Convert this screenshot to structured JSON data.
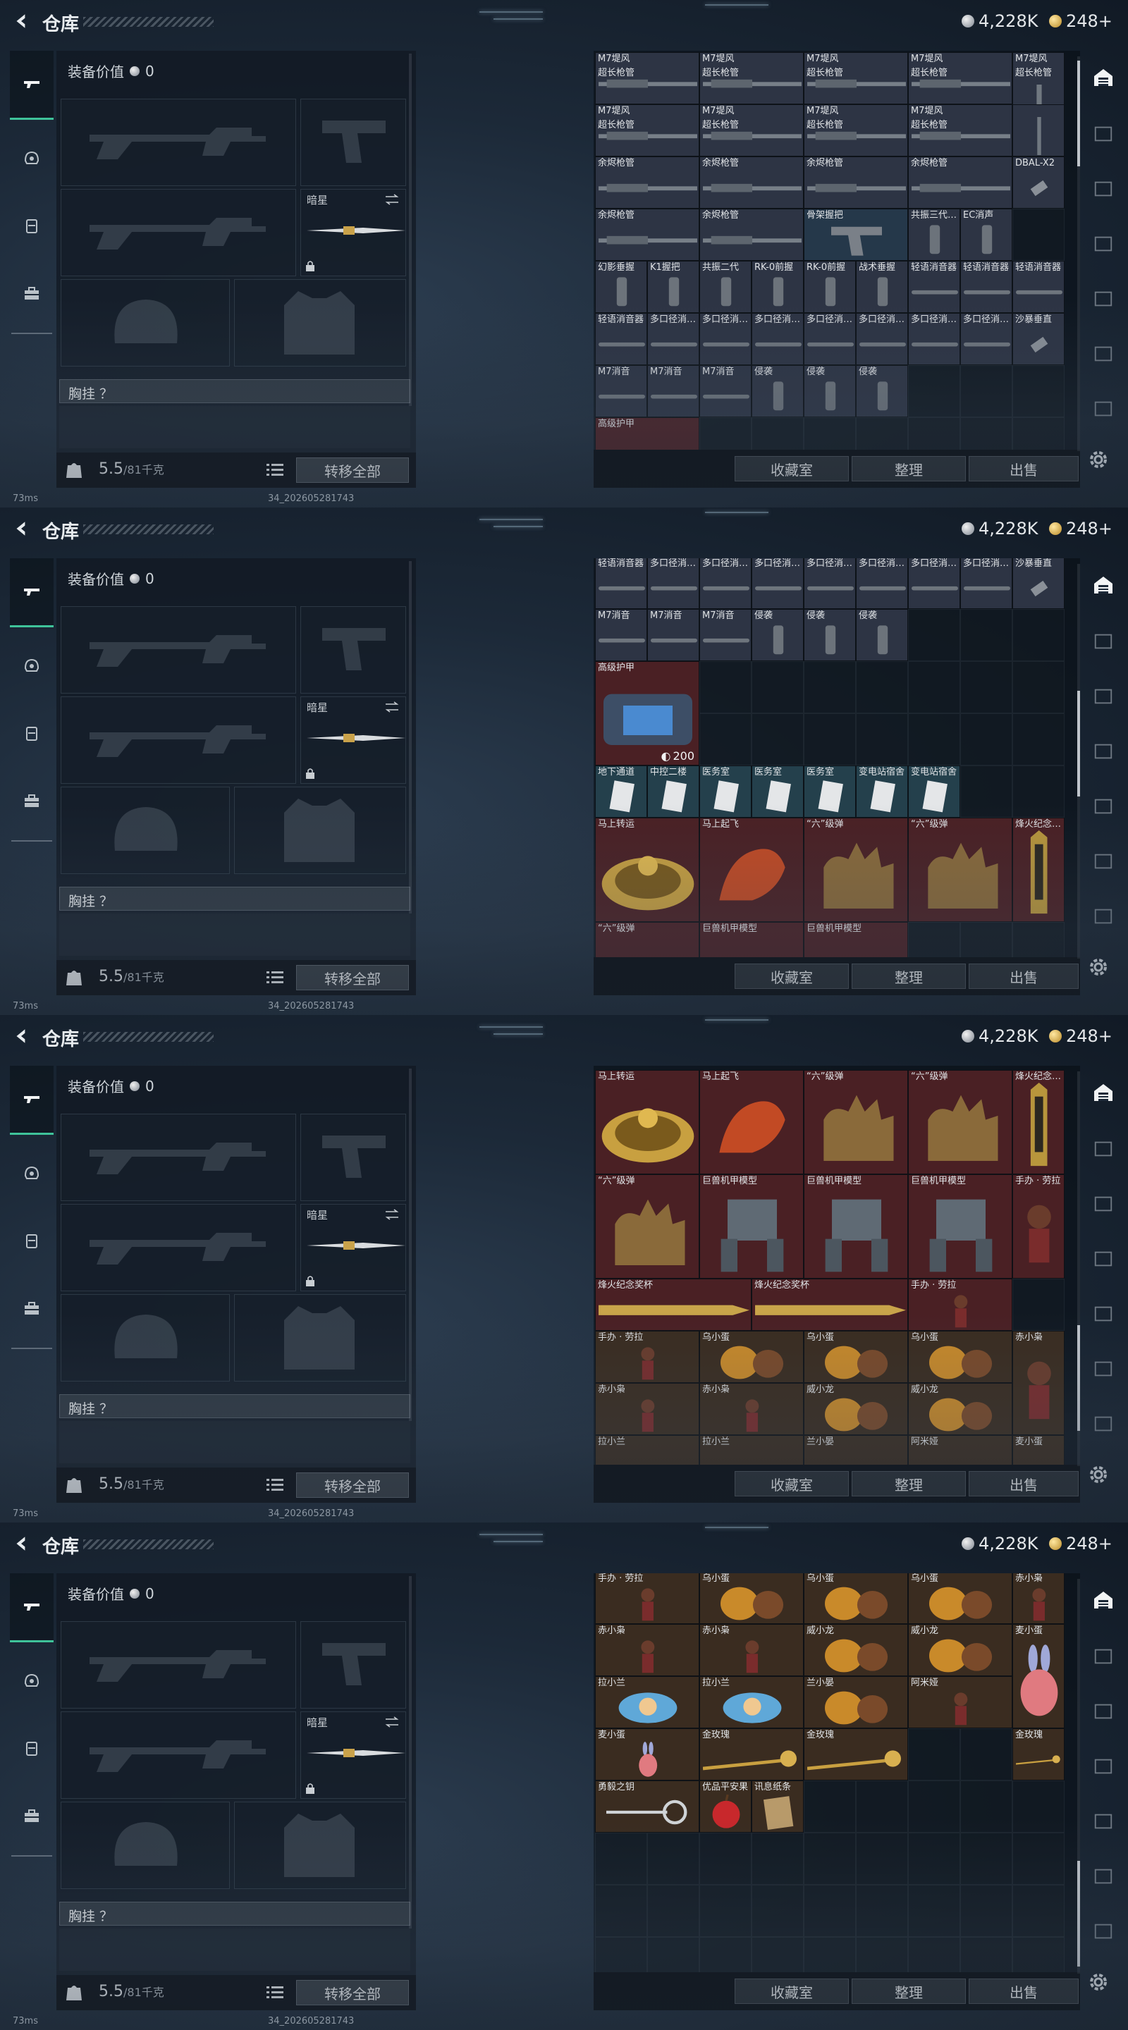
{
  "colors": {
    "accent_green": "#3fc39a",
    "weapon_cell": "#2d3444",
    "weapon_cell_blue": "#25384a",
    "collectible_red": "#4a2024",
    "collectible_brown": "#3a2c20",
    "medical_teal": "#24404c"
  },
  "topbar": {
    "back_icon": "chevron-left-icon",
    "title": "仓库",
    "silver": "4,228K",
    "gold": "248+"
  },
  "left_nav": [
    "gun-icon",
    "helmet-icon",
    "vest-icon",
    "backpack-icon"
  ],
  "equipment": {
    "value_label": "装备价值",
    "value": "0",
    "knife_label": "暗星",
    "chest_label": "胸挂 ？",
    "weight": "5.5",
    "weight_max": "/81千克",
    "transfer_all": "转移全部"
  },
  "status": {
    "ping": "73ms",
    "uid": "34_202605281743"
  },
  "storage": {
    "buttons": {
      "collection": "收藏室",
      "sort": "整理",
      "sell": "出售"
    },
    "screens": [
      {
        "cells": [
          {
            "label": "M7堤风",
            "label2": "超长枪管",
            "bg": "weapon",
            "art": "barrel"
          },
          {
            "label": "M7堤风",
            "label2": "超长枪管",
            "bg": "weapon",
            "art": "barrel"
          },
          {
            "label": "M7堤风",
            "label2": "超长枪管",
            "bg": "weapon",
            "art": "barrel"
          },
          {
            "label": "M7堤风",
            "label2": "超长枪管",
            "bg": "weapon",
            "art": "barrel"
          },
          {
            "label": "M7堤风",
            "label2": "超长枪管",
            "bg": "weapon",
            "art": "vertical"
          },
          {
            "label": "M7堤风",
            "label2": "超长枪管",
            "bg": "weapon",
            "art": "barrel"
          },
          {
            "label": "M7堤风",
            "label2": "超长枪管",
            "bg": "weapon",
            "art": "barrel"
          },
          {
            "label": "M7堤风",
            "label2": "超长枪管",
            "bg": "weapon",
            "art": "barrel"
          },
          {
            "label": "M7堤风",
            "label2": "超长枪管",
            "bg": "weapon",
            "art": "barrel"
          },
          {
            "label": "",
            "label2": "",
            "bg": "weapon",
            "art": "vertical"
          },
          {
            "label": "余烬枪管",
            "label2": "",
            "bg": "weapon",
            "art": "barrel"
          },
          {
            "label": "余烬枪管",
            "label2": "",
            "bg": "weapon",
            "art": "barrel"
          },
          {
            "label": "余烬枪管",
            "label2": "",
            "bg": "weapon",
            "art": "barrel"
          },
          {
            "label": "余烬枪管",
            "label2": "",
            "bg": "weapon",
            "art": "barrel"
          },
          {
            "label": "DBAL-X2",
            "label2": "",
            "bg": "weapon",
            "art": "small"
          },
          {
            "label": "余烬枪管",
            "label2": "",
            "bg": "weapon",
            "art": "barrel"
          },
          {
            "label": "余烬枪管",
            "label2": "",
            "bg": "weapon",
            "art": "barrel"
          },
          {
            "label": "骨架握把",
            "label2": "",
            "bg": "weapon_blue",
            "art": "pistol"
          },
          {
            "label": "共振三代…",
            "label2": "",
            "bg": "weapon",
            "art": "grip"
          },
          {
            "label": "EC消声",
            "label2": "",
            "bg": "weapon",
            "art": "grip"
          },
          {
            "label": "幻影垂握",
            "label2": "",
            "bg": "weapon",
            "art": "grip"
          },
          {
            "label": "K1握把",
            "label2": "",
            "bg": "weapon",
            "art": "grip"
          },
          {
            "label": "共振二代",
            "label2": "",
            "bg": "weapon",
            "art": "grip"
          },
          {
            "label": "RK-0前握",
            "label2": "",
            "bg": "weapon",
            "art": "grip"
          },
          {
            "label": "RK-0前握",
            "label2": "",
            "bg": "weapon",
            "art": "grip"
          },
          {
            "label": "战术垂握",
            "label2": "",
            "bg": "weapon",
            "art": "grip"
          },
          {
            "label": "轻语消音器",
            "label2": "",
            "bg": "weapon",
            "art": "suppressor"
          },
          {
            "label": "轻语消音器",
            "label2": "",
            "bg": "weapon",
            "art": "suppressor"
          },
          {
            "label": "轻语消音器",
            "label2": "",
            "bg": "weapon",
            "art": "suppressor"
          },
          {
            "label": "轻语消音器",
            "label2": "",
            "bg": "weapon",
            "art": "suppressor"
          },
          {
            "label": "多口径消…",
            "label2": "",
            "bg": "weapon",
            "art": "suppressor"
          },
          {
            "label": "多口径消…",
            "label2": "",
            "bg": "weapon",
            "art": "suppressor"
          },
          {
            "label": "多口径消…",
            "label2": "",
            "bg": "weapon",
            "art": "suppressor"
          },
          {
            "label": "多口径消…",
            "label2": "",
            "bg": "weapon",
            "art": "suppressor"
          },
          {
            "label": "多口径消…",
            "label2": "",
            "bg": "weapon",
            "art": "suppressor"
          },
          {
            "label": "多口径消…",
            "label2": "",
            "bg": "weapon",
            "art": "suppressor"
          },
          {
            "label": "多口径消…",
            "label2": "",
            "bg": "weapon",
            "art": "suppressor"
          },
          {
            "label": "多口径消…",
            "label2": "",
            "bg": "weapon",
            "art": "suppressor"
          },
          {
            "label": "沙暴垂直",
            "label2": "",
            "bg": "weapon",
            "art": "small"
          },
          {
            "label": "M7消音",
            "label2": "",
            "bg": "weapon",
            "art": "suppressor"
          },
          {
            "label": "M7消音",
            "label2": "",
            "bg": "weapon",
            "art": "suppressor"
          },
          {
            "label": "M7消音",
            "label2": "",
            "bg": "weapon",
            "art": "suppressor"
          },
          {
            "label": "侵袭",
            "label2": "",
            "bg": "weapon",
            "art": "grip"
          },
          {
            "label": "侵袭",
            "label2": "",
            "bg": "weapon",
            "art": "grip"
          },
          {
            "label": "侵袭",
            "label2": "",
            "bg": "weapon",
            "art": "grip"
          },
          {
            "label": "高级护甲",
            "label2": "",
            "bg": "red",
            "art": "none"
          }
        ]
      },
      {
        "cells": [
          {
            "label": "轻语消音器",
            "label2": "",
            "bg": "weapon",
            "art": "suppressor"
          },
          {
            "label": "多口径消…",
            "label2": "",
            "bg": "weapon",
            "art": "suppressor"
          },
          {
            "label": "多口径消…",
            "label2": "",
            "bg": "weapon",
            "art": "suppressor"
          },
          {
            "label": "多口径消…",
            "label2": "",
            "bg": "weapon",
            "art": "suppressor"
          },
          {
            "label": "多口径消…",
            "label2": "",
            "bg": "weapon",
            "art": "suppressor"
          },
          {
            "label": "多口径消…",
            "label2": "",
            "bg": "weapon",
            "art": "suppressor"
          },
          {
            "label": "多口径消…",
            "label2": "",
            "bg": "weapon",
            "art": "suppressor"
          },
          {
            "label": "多口径消…",
            "label2": "",
            "bg": "weapon",
            "art": "suppressor"
          },
          {
            "label": "沙暴垂直",
            "label2": "",
            "bg": "weapon",
            "art": "small"
          },
          {
            "label": "M7消音",
            "label2": "",
            "bg": "weapon",
            "art": "suppressor"
          },
          {
            "label": "M7消音",
            "label2": "",
            "bg": "weapon",
            "art": "suppressor"
          },
          {
            "label": "M7消音",
            "label2": "",
            "bg": "weapon",
            "art": "suppressor"
          },
          {
            "label": "侵袭",
            "label2": "",
            "bg": "weapon",
            "art": "grip"
          },
          {
            "label": "侵袭",
            "label2": "",
            "bg": "weapon",
            "art": "grip"
          },
          {
            "label": "侵袭",
            "label2": "",
            "bg": "weapon",
            "art": "grip"
          },
          {
            "label": "高级护甲",
            "label2": "",
            "bg": "red",
            "art": "armor",
            "count": "200"
          },
          {
            "label": "地下通道",
            "label2": "",
            "bg": "teal",
            "art": "card"
          },
          {
            "label": "中控二楼",
            "label2": "",
            "bg": "teal",
            "art": "card"
          },
          {
            "label": "医务室",
            "label2": "",
            "bg": "teal",
            "art": "card"
          },
          {
            "label": "医务室",
            "label2": "",
            "bg": "teal",
            "art": "card"
          },
          {
            "label": "医务室",
            "label2": "",
            "bg": "teal",
            "art": "card"
          },
          {
            "label": "变电站宿舍",
            "label2": "",
            "bg": "teal",
            "art": "card"
          },
          {
            "label": "变电站宿舍",
            "label2": "",
            "bg": "teal",
            "art": "card"
          },
          {
            "label": "马上转运",
            "label2": "",
            "bg": "red",
            "art": "gold-disc"
          },
          {
            "label": "马上起飞",
            "label2": "",
            "bg": "red",
            "art": "horse"
          },
          {
            "label": "“六”级弹",
            "label2": "",
            "bg": "red",
            "art": "hand"
          },
          {
            "label": "“六”级弹",
            "label2": "",
            "bg": "red",
            "art": "hand"
          },
          {
            "label": "烽火纪念…",
            "label2": "",
            "bg": "red",
            "art": "trophy"
          },
          {
            "label": "“六”级弹",
            "label2": "",
            "bg": "red",
            "art": "none"
          },
          {
            "label": "巨兽机甲模型",
            "label2": "",
            "bg": "red",
            "art": "none"
          },
          {
            "label": "巨兽机甲模型",
            "label2": "",
            "bg": "red",
            "art": "none"
          }
        ]
      },
      {
        "cells": [
          {
            "label": "马上转运",
            "label2": "",
            "bg": "red",
            "art": "gold-disc"
          },
          {
            "label": "马上起飞",
            "label2": "",
            "bg": "red",
            "art": "horse"
          },
          {
            "label": "“六”级弹",
            "label2": "",
            "bg": "red",
            "art": "hand"
          },
          {
            "label": "“六”级弹",
            "label2": "",
            "bg": "red",
            "art": "hand"
          },
          {
            "label": "烽火纪念…",
            "label2": "",
            "bg": "red",
            "art": "trophy"
          },
          {
            "label": "“六”级弹",
            "label2": "",
            "bg": "red",
            "art": "hand"
          },
          {
            "label": "巨兽机甲模型",
            "label2": "",
            "bg": "red",
            "art": "mech"
          },
          {
            "label": "巨兽机甲模型",
            "label2": "",
            "bg": "red",
            "art": "mech"
          },
          {
            "label": "巨兽机甲模型",
            "label2": "",
            "bg": "red",
            "art": "mech"
          },
          {
            "label": "手办 · 劳拉",
            "label2": "",
            "bg": "red",
            "art": "figure"
          },
          {
            "label": "烽火纪念奖杯",
            "label2": "",
            "bg": "red",
            "art": "bar"
          },
          {
            "label": "烽火纪念奖杯",
            "label2": "",
            "bg": "red",
            "art": "bar"
          },
          {
            "label": "手办 · 劳拉",
            "label2": "",
            "bg": "red",
            "art": "figure"
          },
          {
            "label": "手办 · 劳拉",
            "label2": "",
            "bg": "brown",
            "art": "figure"
          },
          {
            "label": "乌小蛋",
            "label2": "",
            "bg": "brown",
            "art": "egg"
          },
          {
            "label": "乌小蛋",
            "label2": "",
            "bg": "brown",
            "art": "egg"
          },
          {
            "label": "乌小蛋",
            "label2": "",
            "bg": "brown",
            "art": "egg"
          },
          {
            "label": "赤小枭",
            "label2": "",
            "bg": "brown",
            "art": "figure"
          },
          {
            "label": "赤小枭",
            "label2": "",
            "bg": "brown",
            "art": "figure"
          },
          {
            "label": "赤小枭",
            "label2": "",
            "bg": "brown",
            "art": "figure"
          },
          {
            "label": "威小龙",
            "label2": "",
            "bg": "brown",
            "art": "egg"
          },
          {
            "label": "威小龙",
            "label2": "",
            "bg": "brown",
            "art": "egg"
          },
          {
            "label": "拉小兰",
            "label2": "",
            "bg": "brown",
            "art": "none"
          },
          {
            "label": "拉小兰",
            "label2": "",
            "bg": "brown",
            "art": "none"
          },
          {
            "label": "兰小晏",
            "label2": "",
            "bg": "brown",
            "art": "none"
          },
          {
            "label": "阿米娅",
            "label2": "",
            "bg": "brown",
            "art": "none"
          },
          {
            "label": "麦小蛋",
            "label2": "",
            "bg": "brown",
            "art": "none"
          }
        ]
      },
      {
        "cells": [
          {
            "label": "手办 · 劳拉",
            "label2": "",
            "bg": "brown",
            "art": "figure"
          },
          {
            "label": "乌小蛋",
            "label2": "",
            "bg": "brown",
            "art": "egg"
          },
          {
            "label": "乌小蛋",
            "label2": "",
            "bg": "brown",
            "art": "egg"
          },
          {
            "label": "乌小蛋",
            "label2": "",
            "bg": "brown",
            "art": "egg"
          },
          {
            "label": "赤小枭",
            "label2": "",
            "bg": "brown",
            "art": "figure"
          },
          {
            "label": "赤小枭",
            "label2": "",
            "bg": "brown",
            "art": "figure"
          },
          {
            "label": "赤小枭",
            "label2": "",
            "bg": "brown",
            "art": "figure"
          },
          {
            "label": "威小龙",
            "label2": "",
            "bg": "brown",
            "art": "egg"
          },
          {
            "label": "威小龙",
            "label2": "",
            "bg": "brown",
            "art": "egg"
          },
          {
            "label": "拉小兰",
            "label2": "",
            "bg": "brown",
            "art": "blue-fig"
          },
          {
            "label": "拉小兰",
            "label2": "",
            "bg": "brown",
            "art": "blue-fig"
          },
          {
            "label": "兰小晏",
            "label2": "",
            "bg": "brown",
            "art": "egg"
          },
          {
            "label": "阿米娅",
            "label2": "",
            "bg": "brown",
            "art": "figure"
          },
          {
            "label": "麦小蛋",
            "label2": "",
            "bg": "brown",
            "art": "bunny"
          },
          {
            "label": "麦小蛋",
            "label2": "",
            "bg": "brown",
            "art": "bunny"
          },
          {
            "label": "金玫瑰",
            "label2": "",
            "bg": "brown",
            "art": "rose"
          },
          {
            "label": "金玫瑰",
            "label2": "",
            "bg": "brown",
            "art": "rose"
          },
          {
            "label": "金玫瑰",
            "label2": "",
            "bg": "brown",
            "art": "rose"
          },
          {
            "label": "勇毅之钥",
            "label2": "",
            "bg": "brown",
            "art": "key"
          },
          {
            "label": "优品平安果",
            "label2": "",
            "bg": "brown",
            "art": "apple"
          },
          {
            "label": "讯息纸条",
            "label2": "",
            "bg": "brown",
            "art": "paper"
          }
        ]
      }
    ]
  }
}
